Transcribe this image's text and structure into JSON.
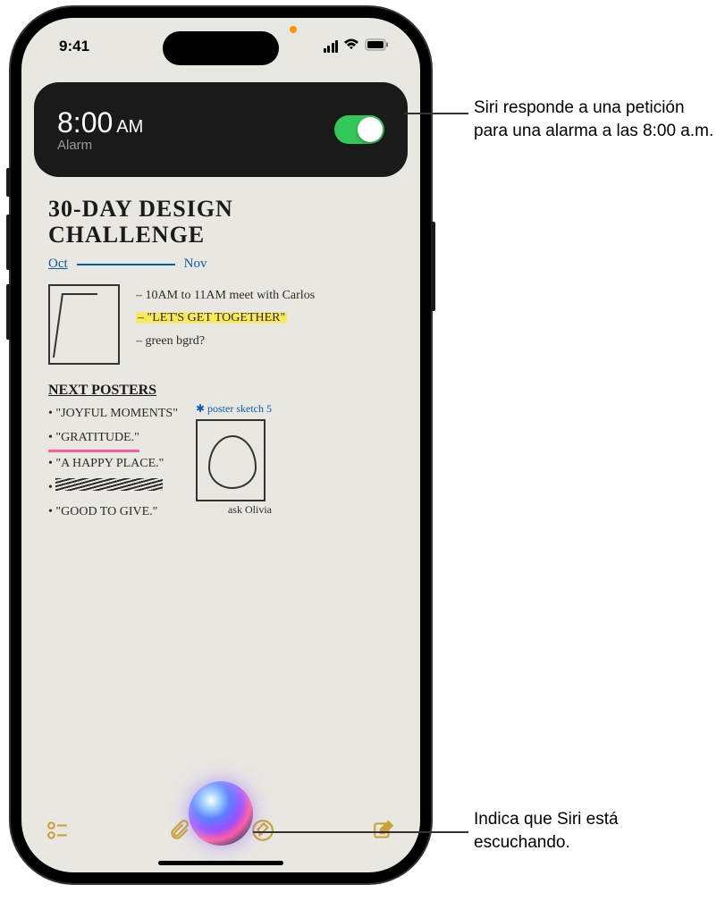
{
  "status_bar": {
    "time": "9:41"
  },
  "alarm": {
    "time": "8:00",
    "ampm": "AM",
    "label": "Alarm",
    "enabled": true
  },
  "note": {
    "title_line1": "30-DAY DESIGN",
    "title_line2": "CHALLENGE",
    "timeline_start": "Oct",
    "timeline_end": "Nov",
    "meeting_1": "– 10AM to 11AM meet with Carlos",
    "meeting_2": "– \"LET'S GET TOGETHER\"",
    "meeting_3": "– green bgrd?",
    "section_header": "NEXT POSTERS",
    "poster_1": "• \"JOYFUL MOMENTS\"",
    "poster_2": "• \"GRATITUDE.\"",
    "poster_3": "• \"A HAPPY PLACE.\"",
    "poster_5": "• \"GOOD TO GIVE.\"",
    "sketch_label": "✱ poster sketch 5",
    "ask_olivia": "ask Olivia"
  },
  "callouts": {
    "c1": "Siri responde a una petición para una alarma a las 8:00 a.m.",
    "c2": "Indica que Siri está escuchando."
  }
}
